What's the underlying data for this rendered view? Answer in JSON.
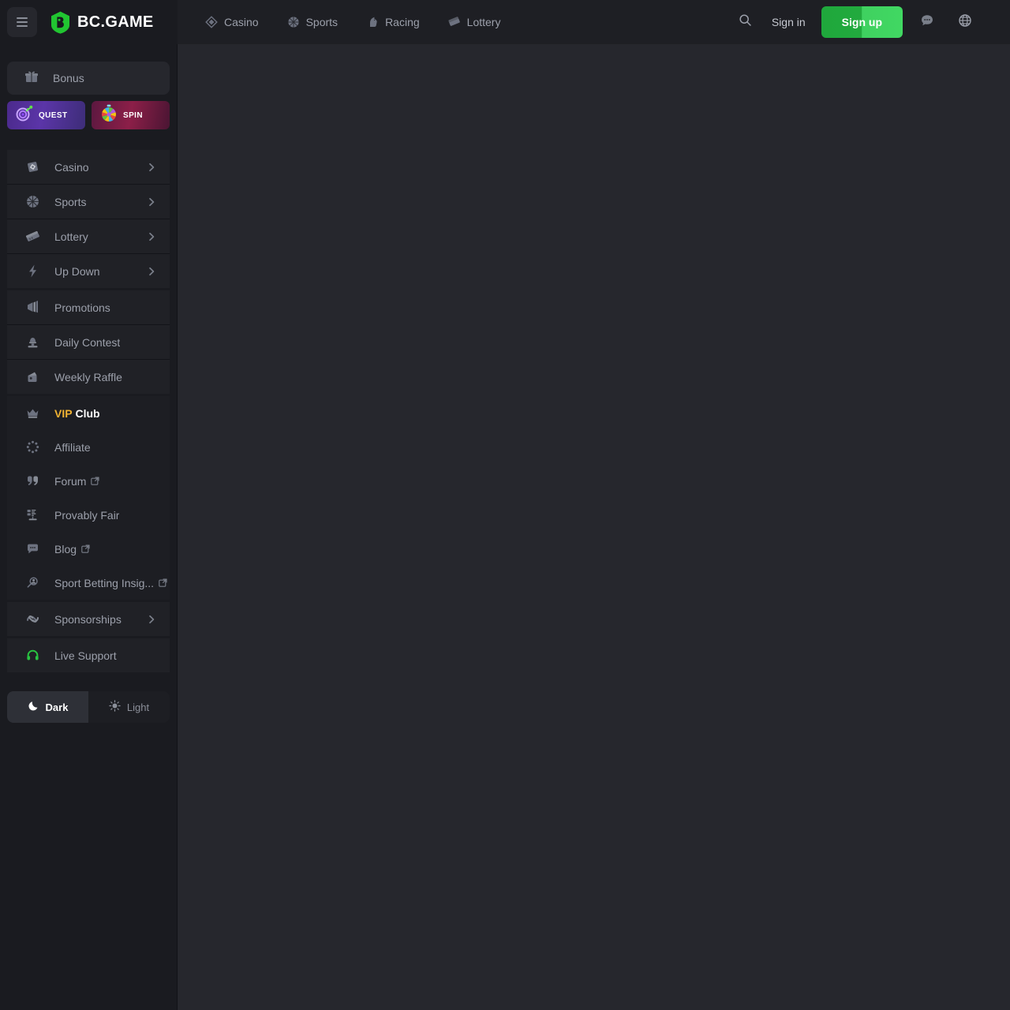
{
  "header": {
    "menu_button": "menu-toggle",
    "logo_text": "BC.GAME",
    "nav": [
      {
        "label": "Casino",
        "icon": "casino-diamond-icon"
      },
      {
        "label": "Sports",
        "icon": "basketball-icon"
      },
      {
        "label": "Racing",
        "icon": "horse-icon"
      },
      {
        "label": "Lottery",
        "icon": "ticket-icon"
      }
    ],
    "search_label": "search-icon",
    "sign_in": "Sign in",
    "sign_up": "Sign up",
    "chat_label": "chat-icon",
    "language_label": "globe-icon",
    "signup_color": "#41d862"
  },
  "sidebar": {
    "bonus": {
      "label": "Bonus",
      "icon": "gift-icon"
    },
    "promos": [
      {
        "label": "QUEST",
        "icon": "quest-target-icon",
        "color": "#5b35a8"
      },
      {
        "label": "SPIN",
        "icon": "spin-wheel-icon",
        "color": "#8c1f48"
      }
    ],
    "groups": [
      {
        "style": "hl",
        "items": [
          {
            "label": "Casino",
            "icon": "casino-diamond-icon",
            "chevron": true,
            "external": false
          },
          {
            "label": "Sports",
            "icon": "basketball-icon",
            "chevron": true,
            "external": false
          },
          {
            "label": "Lottery",
            "icon": "ticket-icon",
            "chevron": true,
            "external": false
          },
          {
            "label": "Up Down",
            "icon": "lightning-icon",
            "chevron": true,
            "external": false
          }
        ]
      },
      {
        "style": "hl",
        "items": [
          {
            "label": "Promotions",
            "icon": "megaphone-icon",
            "chevron": false,
            "external": false
          },
          {
            "label": "Daily Contest",
            "icon": "trophy-stamp-icon",
            "chevron": false,
            "external": false
          },
          {
            "label": "Weekly Raffle",
            "icon": "raffle-box-icon",
            "chevron": false,
            "external": false
          }
        ]
      },
      {
        "style": "dk",
        "items": [
          {
            "label": "VIP Club",
            "vip_prefix": "VIP",
            "vip_suffix": " Club",
            "icon": "crown-icon",
            "chevron": false,
            "external": false
          },
          {
            "label": "Affiliate",
            "icon": "affiliate-ring-icon",
            "chevron": false,
            "external": false
          },
          {
            "label": "Forum",
            "icon": "forum-icon",
            "chevron": false,
            "external": true
          },
          {
            "label": "Provably Fair",
            "icon": "provably-fair-icon",
            "chevron": false,
            "external": false
          },
          {
            "label": "Blog",
            "icon": "blog-chat-icon",
            "chevron": false,
            "external": true
          },
          {
            "label": "Sport Betting Insig...",
            "icon": "insights-icon",
            "chevron": false,
            "external": true
          }
        ]
      },
      {
        "style": "hl",
        "items": [
          {
            "label": "Sponsorships",
            "icon": "sponsorship-icon",
            "chevron": true,
            "external": false
          }
        ]
      },
      {
        "style": "hl",
        "items": [
          {
            "label": "Live Support",
            "icon": "headset-icon",
            "chevron": false,
            "external": false,
            "icon_color": "#29c441"
          }
        ]
      }
    ],
    "theme": {
      "dark_label": "Dark",
      "light_label": "Light",
      "active": "Dark"
    }
  }
}
